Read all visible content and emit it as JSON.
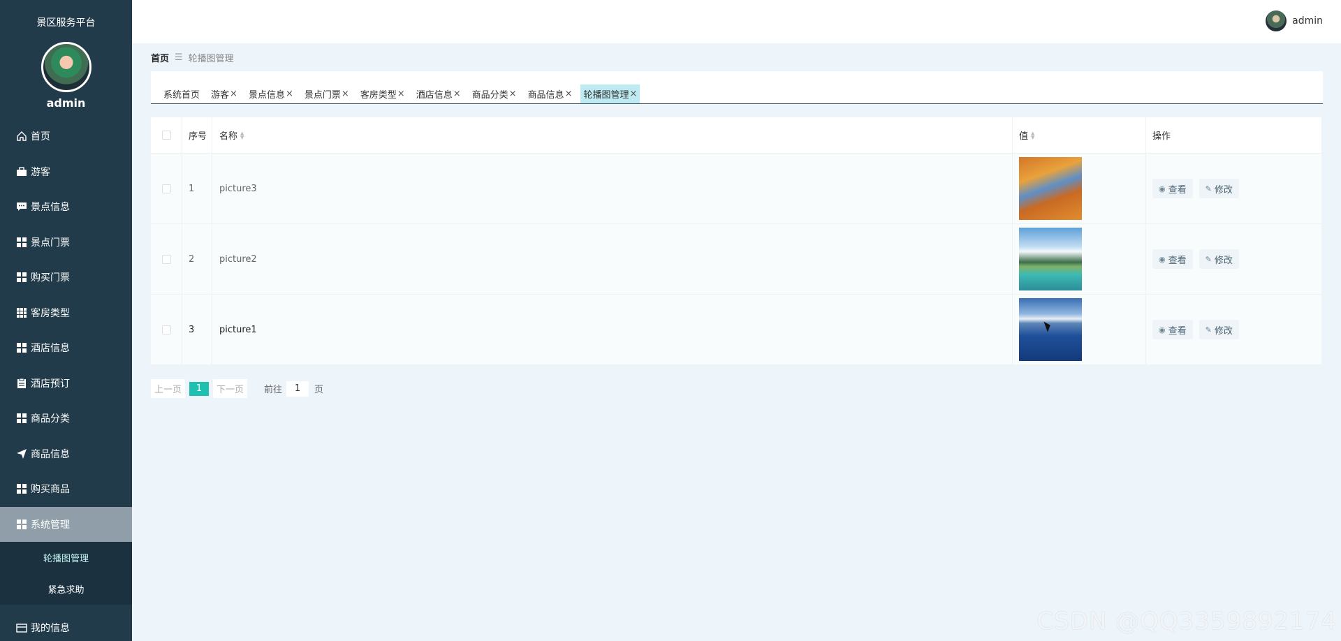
{
  "sidebar": {
    "platform": "景区服务平台",
    "username": "admin",
    "items": [
      {
        "label": "首页",
        "icon": "home-icon"
      },
      {
        "label": "游客",
        "icon": "briefcase-icon"
      },
      {
        "label": "景点信息",
        "icon": "chat-icon"
      },
      {
        "label": "景点门票",
        "icon": "grid-icon"
      },
      {
        "label": "购买门票",
        "icon": "grid-icon"
      },
      {
        "label": "客房类型",
        "icon": "apps-icon"
      },
      {
        "label": "酒店信息",
        "icon": "grid-icon"
      },
      {
        "label": "酒店预订",
        "icon": "clipboard-icon"
      },
      {
        "label": "商品分类",
        "icon": "grid-icon"
      },
      {
        "label": "商品信息",
        "icon": "send-icon"
      },
      {
        "label": "购买商品",
        "icon": "grid-icon"
      },
      {
        "label": "系统管理",
        "icon": "grid-icon"
      }
    ],
    "submenu": [
      {
        "label": "轮播图管理"
      },
      {
        "label": "紧急求助"
      }
    ],
    "my_info": {
      "label": "我的信息",
      "icon": "card-icon"
    }
  },
  "header": {
    "username": "admin"
  },
  "breadcrumb": {
    "home": "首页",
    "separator": "☰",
    "current": "轮播图管理"
  },
  "tabs": [
    {
      "label": "系统首页",
      "closable": false
    },
    {
      "label": "游客",
      "closable": true
    },
    {
      "label": "景点信息",
      "closable": true
    },
    {
      "label": "景点门票",
      "closable": true
    },
    {
      "label": "客房类型",
      "closable": true
    },
    {
      "label": "酒店信息",
      "closable": true
    },
    {
      "label": "商品分类",
      "closable": true
    },
    {
      "label": "商品信息",
      "closable": true
    },
    {
      "label": "轮播图管理",
      "closable": true
    }
  ],
  "table": {
    "columns": {
      "index": "序号",
      "name": "名称",
      "value": "值",
      "actions": "操作"
    },
    "rows": [
      {
        "index": "1",
        "name": "picture3",
        "image": "autumn"
      },
      {
        "index": "2",
        "name": "picture2",
        "image": "beach"
      },
      {
        "index": "3",
        "name": "picture1",
        "image": "sea"
      }
    ],
    "view_label": "查看",
    "edit_label": "修改"
  },
  "pagination": {
    "prev": "上一页",
    "current": "1",
    "next": "下一页",
    "goto": "前往",
    "page_value": "1",
    "page_suffix": "页"
  },
  "watermark": "CSDN @QQ3359892174",
  "colors": {
    "sidebar_bg": "#213b4a",
    "accent": "#1ec0b0",
    "active_tab": "#bdebf1",
    "page_bg": "#edf5fb"
  }
}
